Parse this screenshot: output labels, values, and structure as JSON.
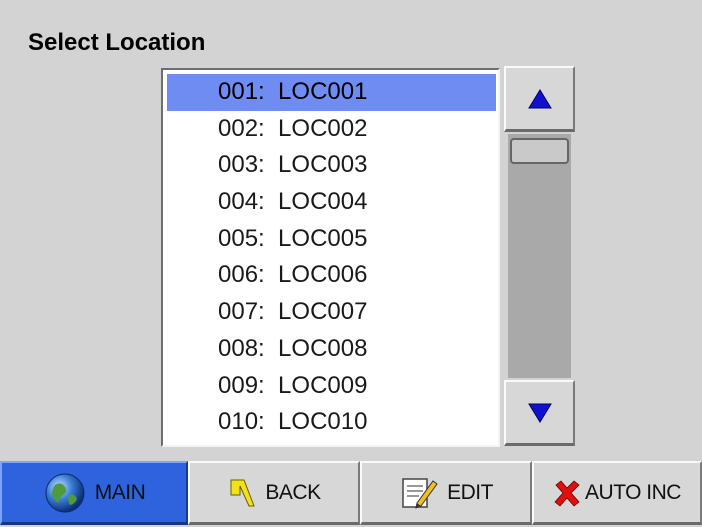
{
  "title": "Select Location",
  "locations": [
    {
      "text": "001:  LOC001",
      "selected": true
    },
    {
      "text": "002:  LOC002",
      "selected": false
    },
    {
      "text": "003:  LOC003",
      "selected": false
    },
    {
      "text": "004:  LOC004",
      "selected": false
    },
    {
      "text": "005:  LOC005",
      "selected": false
    },
    {
      "text": "006:  LOC006",
      "selected": false
    },
    {
      "text": "007:  LOC007",
      "selected": false
    },
    {
      "text": "008:  LOC008",
      "selected": false
    },
    {
      "text": "009:  LOC009",
      "selected": false
    },
    {
      "text": "010:  LOC010",
      "selected": false
    }
  ],
  "scrollbar": {
    "up_icon": "triangle-up-icon",
    "down_icon": "triangle-down-icon"
  },
  "nav": {
    "main": {
      "label": "MAIN",
      "icon": "globe-icon"
    },
    "back": {
      "label": "BACK",
      "icon": "back-arrow-icon"
    },
    "edit": {
      "label": "EDIT",
      "icon": "notepad-pencil-icon"
    },
    "auto_inc": {
      "label": "AUTO INC",
      "icon": "red-x-icon"
    }
  },
  "colors": {
    "selection": "#6f8cf2",
    "active_nav": "#2f63de",
    "arrow": "#1010d0"
  }
}
